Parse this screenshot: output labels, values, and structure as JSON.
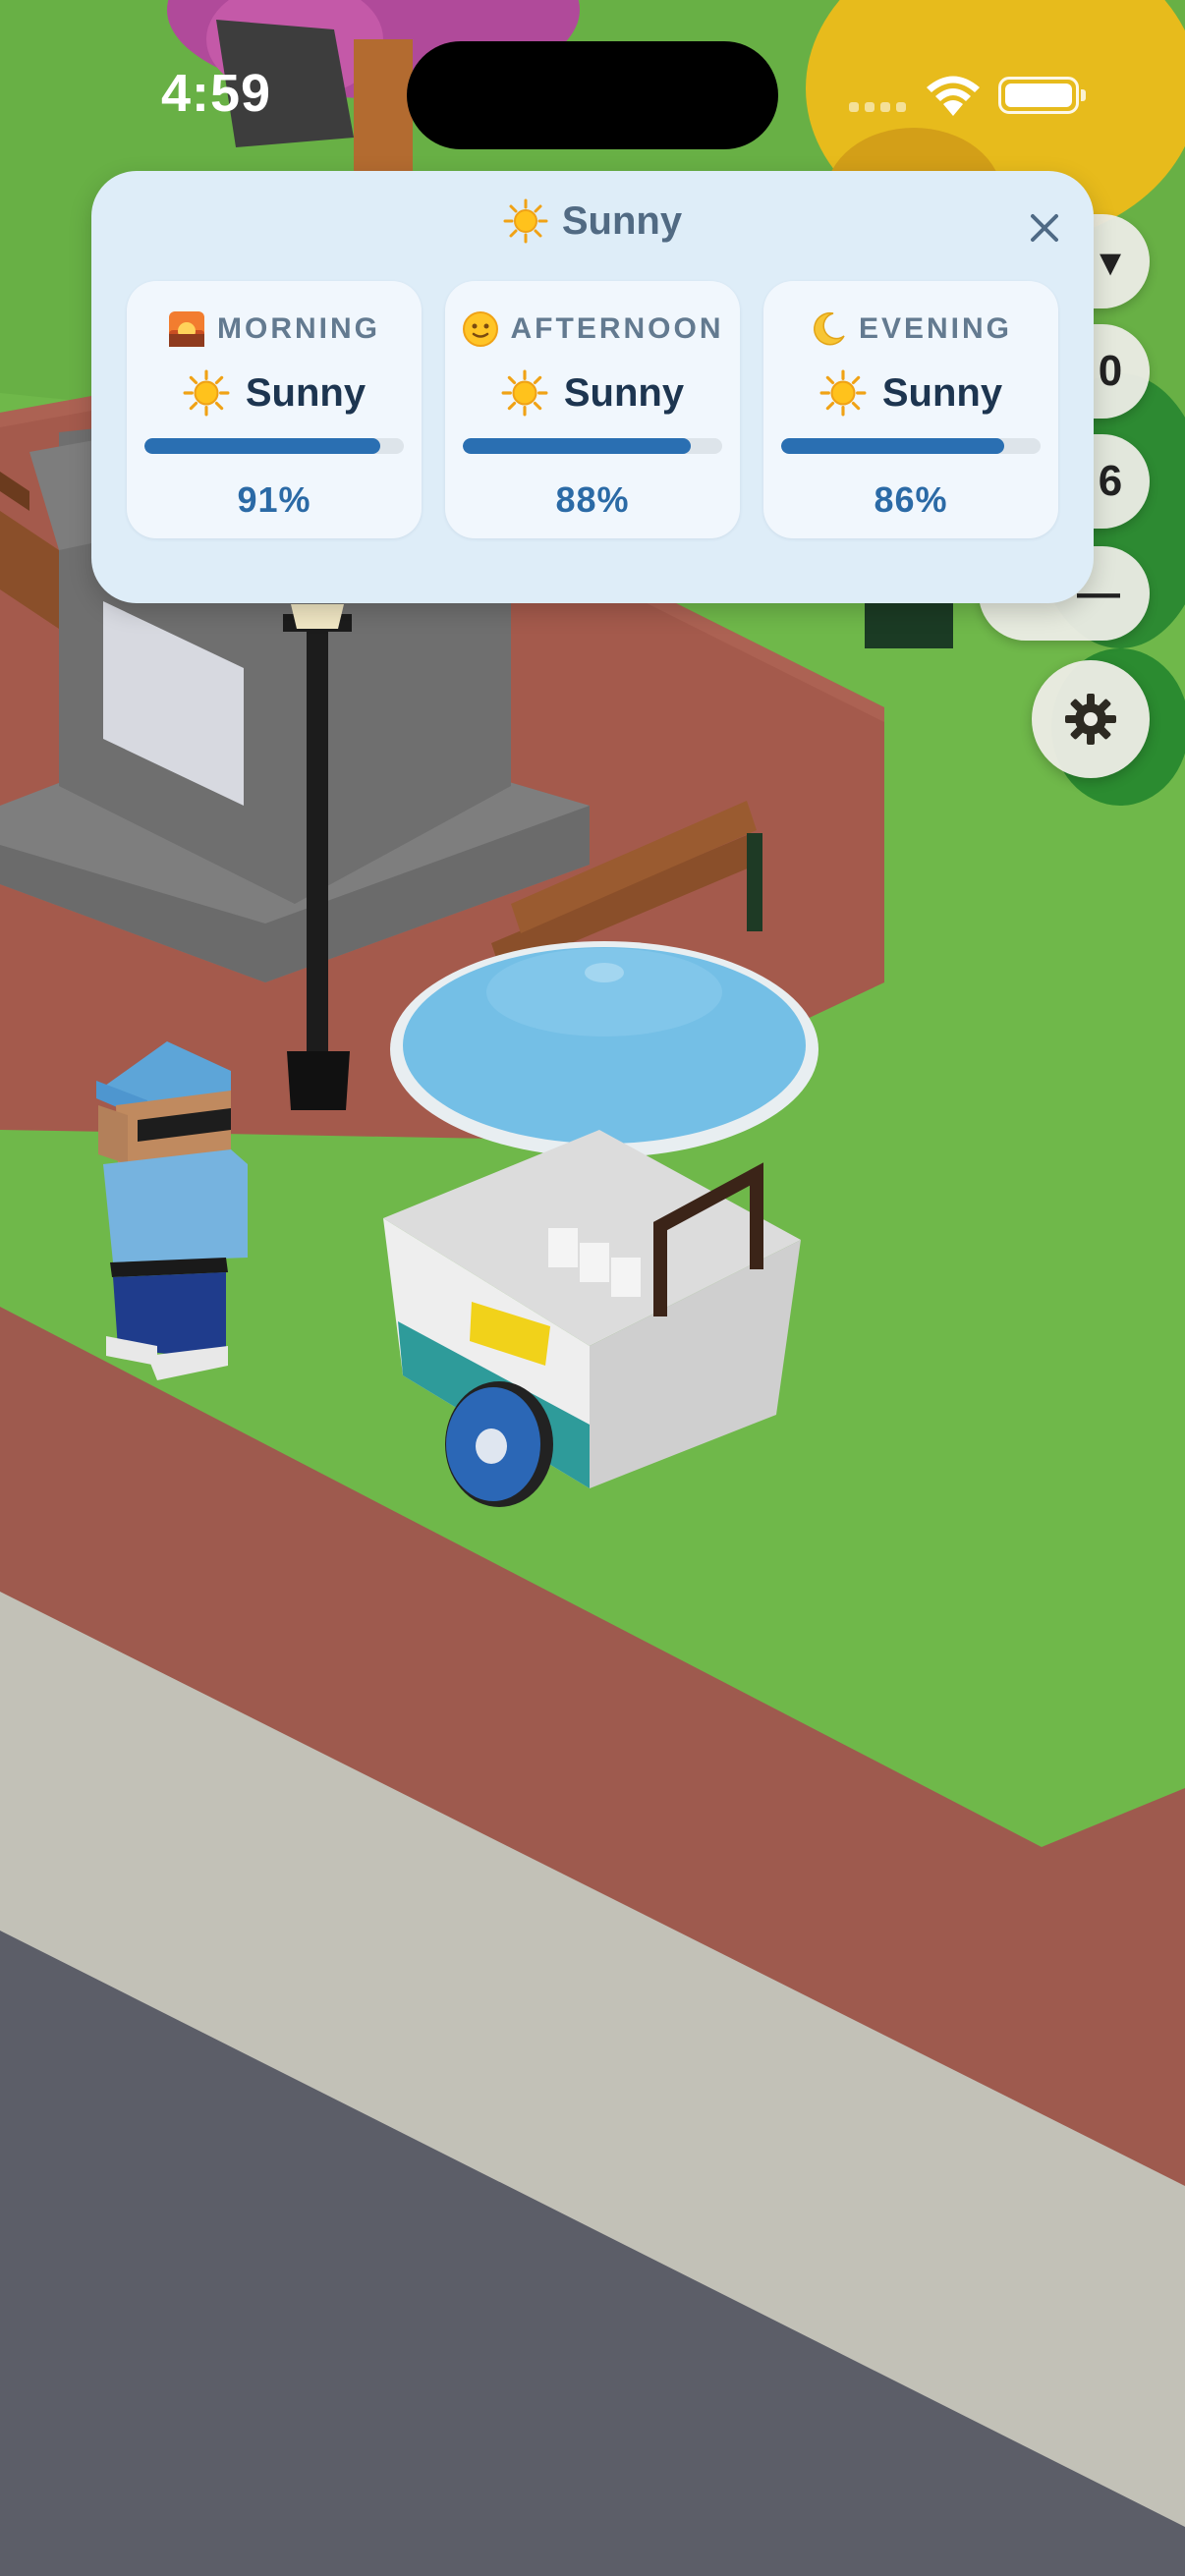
{
  "status_bar": {
    "time": "4:59"
  },
  "weather_panel": {
    "title": "Sunny",
    "title_icon": "sun-icon",
    "close_icon": "close-icon",
    "periods": [
      {
        "name": "MORNING",
        "icon": "sunrise-icon",
        "condition": "Sunny",
        "condition_icon": "sun-icon",
        "confidence": 0.91,
        "confidence_label": "91%"
      },
      {
        "name": "AFTERNOON",
        "icon": "sun-face-icon",
        "condition": "Sunny",
        "condition_icon": "sun-icon",
        "confidence": 0.88,
        "confidence_label": "88%"
      },
      {
        "name": "EVENING",
        "icon": "crescent-moon-icon",
        "condition": "Sunny",
        "condition_icon": "sun-icon",
        "confidence": 0.86,
        "confidence_label": "86%"
      }
    ]
  },
  "side_buttons": [
    {
      "glyph": "▾"
    },
    {
      "glyph": "0"
    },
    {
      "glyph": "6"
    },
    {
      "glyph": "—"
    }
  ],
  "settings_icon": "gear-icon",
  "colors": {
    "grass": "#6fb84a",
    "path": "#9e5a4e",
    "sidewalk": "#c2c1b7",
    "road": "#5c5e68",
    "panel_bg": "#deedf8",
    "bar_fill": "#2a6fb2"
  }
}
